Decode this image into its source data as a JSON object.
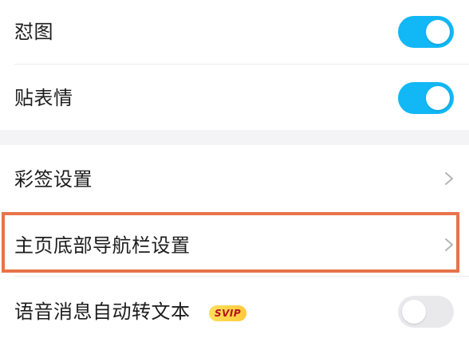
{
  "settings": {
    "items": [
      {
        "label": "怼图",
        "control": "toggle",
        "state": "on"
      },
      {
        "label": "贴表情",
        "control": "toggle",
        "state": "on"
      },
      {
        "label": "彩签设置",
        "control": "chevron"
      },
      {
        "label": "主页底部导航栏设置",
        "control": "chevron",
        "highlighted": true
      },
      {
        "label": "语音消息自动转文本",
        "control": "toggle",
        "state": "off",
        "badge": "SVIP"
      }
    ]
  },
  "colors": {
    "toggle_on": "#12b7f5",
    "toggle_off": "#e9e9ec",
    "highlight_border": "#e8734a",
    "badge_bg": "#ffd24a",
    "badge_text": "#b3121c"
  },
  "icons": {
    "chevron": "chevron-right-icon"
  }
}
